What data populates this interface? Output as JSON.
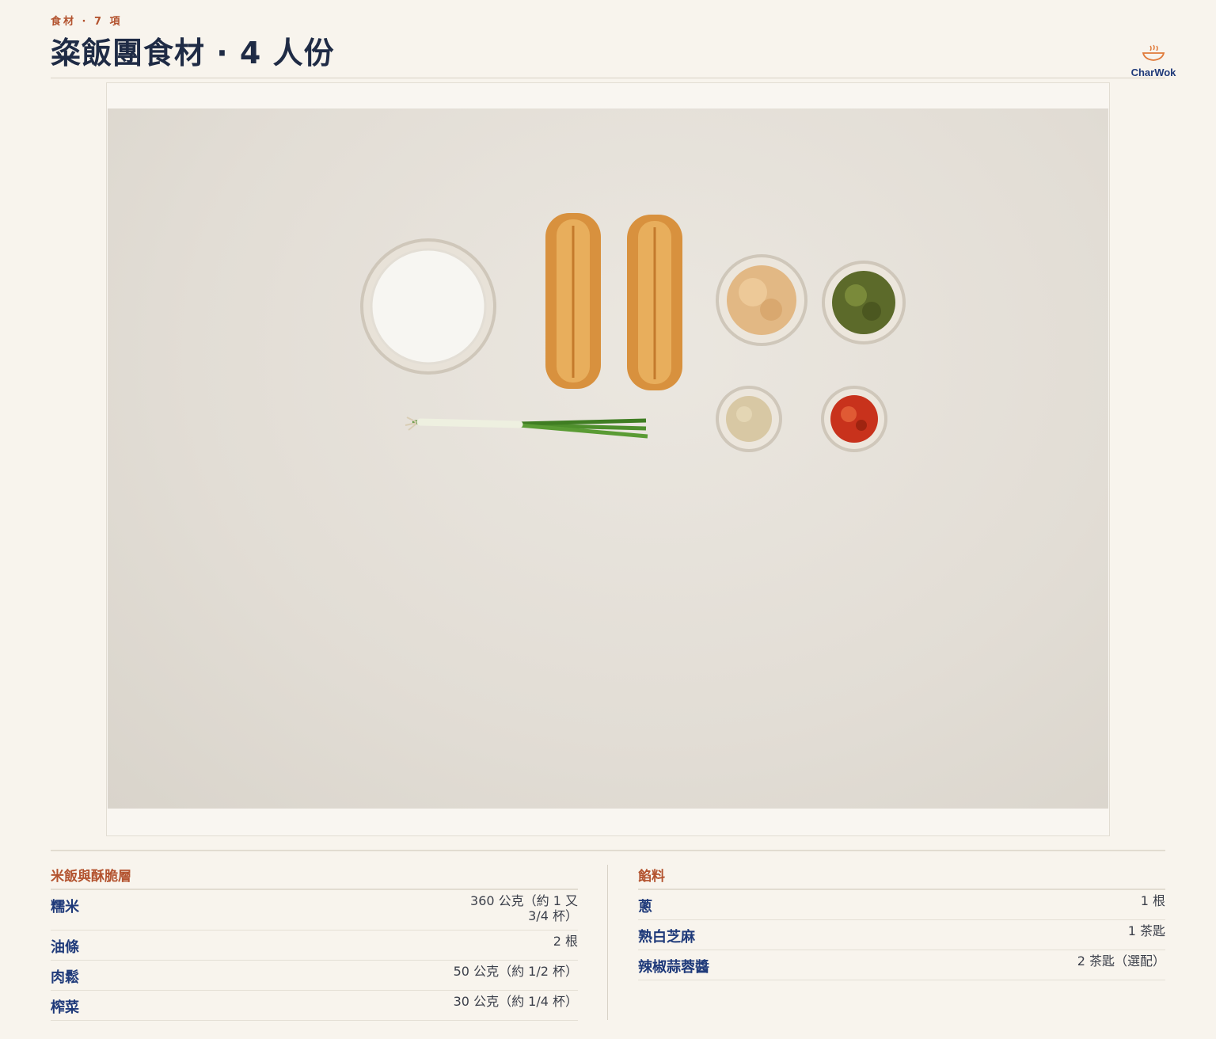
{
  "header": {
    "eyebrow": "食材 · 7 項",
    "title": "粢飯團食材 · 4 人份"
  },
  "brand": {
    "logo_text": "CharWok",
    "accent": "#e07a3a"
  },
  "photo": {
    "icon": "ingredients-flatlay-photo"
  },
  "sections": [
    {
      "heading": "米飯與酥脆層",
      "items": [
        {
          "name": "糯米",
          "qty": "360 公克（約 1 又 3/4 杯）"
        },
        {
          "name": "油條",
          "qty": "2 根"
        },
        {
          "name": "肉鬆",
          "qty": "50 公克（約 1/2 杯）"
        },
        {
          "name": "榨菜",
          "qty": "30 公克（約 1/4 杯）"
        }
      ]
    },
    {
      "heading": "餡料",
      "items": [
        {
          "name": "蔥",
          "qty": "1 根"
        },
        {
          "name": "熟白芝麻",
          "qty": "1 茶匙"
        },
        {
          "name": "辣椒蒜蓉醬",
          "qty": "2 茶匙（選配）"
        }
      ]
    }
  ],
  "colors": {
    "background": "#f8f4ed",
    "heading": "#1f2b45",
    "section_accent": "#b3532f",
    "item_name": "#1f3a7a"
  }
}
